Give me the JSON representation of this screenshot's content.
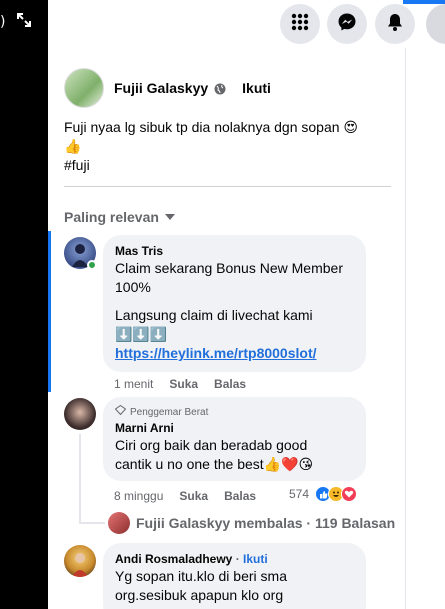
{
  "post": {
    "author": "Fujii Galaskyy",
    "follow_label": "Ikuti",
    "text_line1": "Fuji nyaa lg sibuk tp dia nolaknya dgn sopan 😍",
    "text_line2": "👍",
    "hashtag": "#fuji"
  },
  "comments_sort": "Paling relevan",
  "comments": [
    {
      "author": "Mas Tris",
      "line1": "Claim sekarang Bonus New Member",
      "line2": "100%",
      "line3": "Langsung claim di livechat kami",
      "arrows": "⬇️⬇️⬇️",
      "link": "https://heylink.me/rtp8000slot/",
      "time": "1 menit",
      "like": "Suka",
      "reply": "Balas"
    },
    {
      "badge": "Penggemar Berat",
      "author": "Marni Arni",
      "line1": "Ciri org baik dan beradab good",
      "line2": "cantik u no one the best👍❤️😘",
      "time": "8 minggu",
      "like": "Suka",
      "reply": "Balas",
      "reaction_count": "574"
    },
    {
      "author": "Andi Rosmaladhewy",
      "follow": "Ikuti",
      "line1": "Yg sopan itu.klo di beri sma",
      "line2": "org.sesibuk apapun klo org"
    }
  ],
  "replies_summary": "Fujii Galaskyy membalas · 119 Balasan",
  "icons": [
    "close-icon",
    "expand-icon",
    "menu-grid-icon",
    "messenger-icon",
    "bell-icon",
    "globe-icon",
    "caret-down-icon",
    "star-badge-icon",
    "like-reaction-icon",
    "haha-reaction-icon",
    "love-reaction-icon"
  ],
  "colors": {
    "accent": "#1877f2",
    "bubble": "#f0f2f5",
    "muted": "#65676b"
  }
}
